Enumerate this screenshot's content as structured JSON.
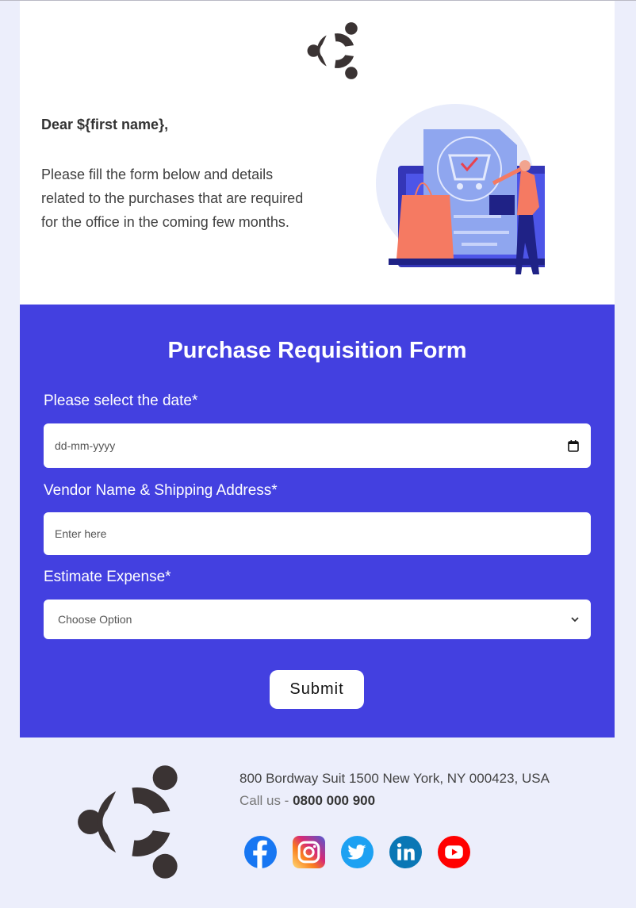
{
  "header": {
    "logo_icon": "ubuntu-style-logo-icon",
    "greeting": "Dear ${first name},",
    "intro": "Please fill the form below and details related to the purchases that are required for the office in the coming few months.",
    "illustration": "shopping-cart-checkout-illustration"
  },
  "form": {
    "title": "Purchase Requisition Form",
    "background_color": "#4340e0",
    "fields": [
      {
        "label": "Please select the date*",
        "type": "date",
        "value": "",
        "placeholder": "dd-mm-yyyy",
        "icon": "calendar-icon"
      },
      {
        "label": "Vendor Name & Shipping Address*",
        "type": "text",
        "value": "",
        "placeholder": "Enter here"
      },
      {
        "label": "Estimate Expense*",
        "type": "select",
        "selected": "Choose Option",
        "icon": "chevron-down-icon"
      }
    ],
    "submit_label": "Submit"
  },
  "footer": {
    "address": "800 Bordway Suit 1500 New York, NY 000423, USA",
    "call_label": "Call us - ",
    "phone": "0800 000 900",
    "socials": [
      {
        "name": "facebook",
        "color": "#1877f2"
      },
      {
        "name": "instagram",
        "color": "#c13584"
      },
      {
        "name": "twitter",
        "color": "#1da1f2"
      },
      {
        "name": "linkedin",
        "color": "#0a66c2"
      },
      {
        "name": "youtube",
        "color": "#ff0000"
      }
    ]
  }
}
